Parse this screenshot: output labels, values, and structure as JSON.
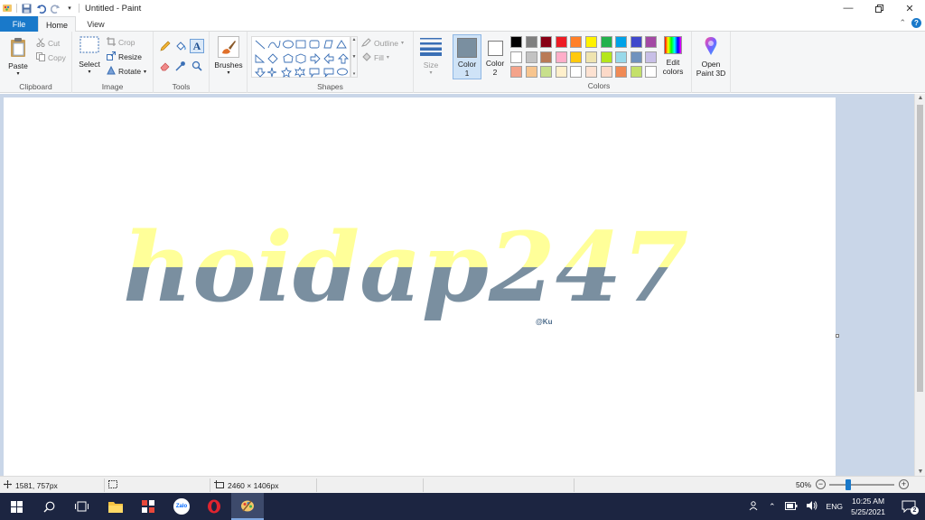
{
  "window": {
    "title": "Untitled - Paint",
    "controls": [
      "minimize",
      "restore",
      "close"
    ]
  },
  "tabs": [
    {
      "label": "File"
    },
    {
      "label": "Home"
    },
    {
      "label": "View"
    }
  ],
  "ribbon": {
    "clipboard": {
      "label": "Clipboard",
      "paste": "Paste",
      "cut": "Cut",
      "copy": "Copy"
    },
    "image": {
      "label": "Image",
      "select": "Select",
      "crop": "Crop",
      "resize": "Resize",
      "rotate": "Rotate"
    },
    "tools": {
      "label": "Tools"
    },
    "brushes": {
      "label": "Brushes"
    },
    "shapes": {
      "label": "Shapes",
      "outline": "Outline",
      "fill": "Fill"
    },
    "size": {
      "label": "Size"
    },
    "color1": {
      "label": "Color",
      "num": "1",
      "color": "#7a8fa0"
    },
    "color2": {
      "label": "Color",
      "num": "2",
      "color": "#ffffff"
    },
    "colors": {
      "label": "Colors",
      "edit": "Edit colors",
      "edit_line1": "Edit",
      "edit_line2": "colors",
      "palette": [
        "#000000",
        "#7f7f7f",
        "#880015",
        "#ed1c24",
        "#ff7f27",
        "#fff200",
        "#22b14c",
        "#00a2e8",
        "#3f48cc",
        "#a349a4",
        "#ffffff",
        "#c3c3c3",
        "#b97a57",
        "#ffaec9",
        "#ffc90e",
        "#efe4b0",
        "#b5e61d",
        "#99d9ea",
        "#7092be",
        "#c8bfe7",
        "#f4a38a",
        "#f7c58f",
        "#c8e08c",
        "#fff0cc",
        "#ffffff",
        "#fde2d2",
        "#fcd9c8",
        "#f08a55",
        "#c4e06a",
        "#ffffff"
      ]
    },
    "paint3d": {
      "line1": "Open",
      "line2": "Paint 3D"
    }
  },
  "canvas": {
    "artwork_text": "hoidap247",
    "signature": "@Ku",
    "ink_top": "#ffff99",
    "ink_bottom": "#7a8fa0"
  },
  "statusbar": {
    "cursor_pos": "1581, 757px",
    "image_size": "2460 × 1406px",
    "zoom": "50%"
  },
  "taskbar": {
    "time": "10:25 AM",
    "date": "5/25/2021",
    "language": "ENG",
    "notification_count": "2"
  }
}
